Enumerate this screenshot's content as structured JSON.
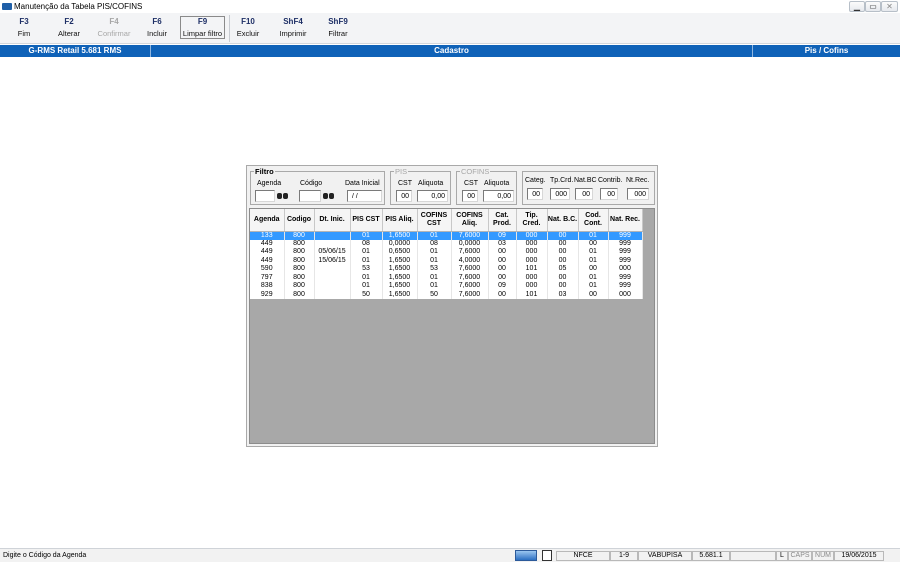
{
  "window": {
    "title": "Manutenção da Tabela PIS/COFINS"
  },
  "toolbar": [
    {
      "key": "F3",
      "label": "Fim"
    },
    {
      "key": "F2",
      "label": "Alterar"
    },
    {
      "key": "F4",
      "label": "Confirmar",
      "disabled": true
    },
    {
      "key": "F6",
      "label": "Incluir"
    },
    {
      "key": "F9",
      "label": "Limpar filtro",
      "active": true
    },
    {
      "key": "F10",
      "label": "Excluir"
    },
    {
      "key": "ShF4",
      "label": "Imprimir"
    },
    {
      "key": "ShF9",
      "label": "Filtrar"
    }
  ],
  "header": {
    "app": "G-RMS Retail 5.681 RMS",
    "section": "Cadastro",
    "module": "Pis / Cofins"
  },
  "filter": {
    "title": "Filtro",
    "agenda_label": "Agenda",
    "agenda_value": "",
    "codigo_label": "Código",
    "codigo_value": "",
    "data_label": "Data Inicial",
    "data_value": " / /"
  },
  "pis": {
    "title": "PIS",
    "cst_label": "CST",
    "cst_value": "00",
    "aliq_label": "Aliquota",
    "aliq_value": "0,00"
  },
  "cofins": {
    "title": "COFINS",
    "cst_label": "CST",
    "cst_value": "00",
    "aliq_label": "Aliquota",
    "aliq_value": "0,00"
  },
  "extra": [
    {
      "label": "Categ.",
      "value": "00"
    },
    {
      "label": "Tp.Crd.",
      "value": "000"
    },
    {
      "label": "Nat.BC",
      "value": "00"
    },
    {
      "label": "Contrib.",
      "value": "00"
    },
    {
      "label": "Nt.Rec.",
      "value": "000"
    }
  ],
  "table": {
    "columns": [
      "Agenda",
      "Codigo",
      "Dt. Inic.",
      "PIS CST",
      "PIS Aliq.",
      "COFINS CST",
      "COFINS Aliq.",
      "Cat. Prod.",
      "Tip. Cred.",
      "Nat. B.C.",
      "Cod. Cont.",
      "Nat. Rec."
    ],
    "rows": [
      [
        "133",
        "800",
        "",
        "01",
        "1,6500",
        "01",
        "7,6000",
        "09",
        "000",
        "00",
        "01",
        "999"
      ],
      [
        "449",
        "800",
        "",
        "08",
        "0,0000",
        "08",
        "0,0000",
        "03",
        "000",
        "00",
        "00",
        "999"
      ],
      [
        "449",
        "800",
        "05/06/15",
        "01",
        "0,6500",
        "01",
        "7,6000",
        "00",
        "000",
        "00",
        "01",
        "999"
      ],
      [
        "449",
        "800",
        "15/06/15",
        "01",
        "1,6500",
        "01",
        "4,0000",
        "00",
        "000",
        "00",
        "01",
        "999"
      ],
      [
        "590",
        "800",
        "",
        "53",
        "1,6500",
        "53",
        "7,6000",
        "00",
        "101",
        "05",
        "00",
        "000"
      ],
      [
        "797",
        "800",
        "",
        "01",
        "1,6500",
        "01",
        "7,6000",
        "00",
        "000",
        "00",
        "01",
        "999"
      ],
      [
        "838",
        "800",
        "",
        "01",
        "1,6500",
        "01",
        "7,6000",
        "09",
        "000",
        "00",
        "01",
        "999"
      ],
      [
        "929",
        "800",
        "",
        "50",
        "1,6500",
        "50",
        "7,6000",
        "00",
        "101",
        "03",
        "00",
        "000"
      ]
    ],
    "selected_row": 0
  },
  "status": {
    "message": "Digite o Código da Agenda",
    "panels": [
      "NFCE",
      "1-9",
      "VABUPISA",
      "5.681.1",
      "",
      "L",
      "CAPS",
      "NUM",
      "19/06/2015"
    ]
  },
  "colors": {
    "header_blue": "#0f62b8",
    "selection_blue": "#3399ff"
  }
}
